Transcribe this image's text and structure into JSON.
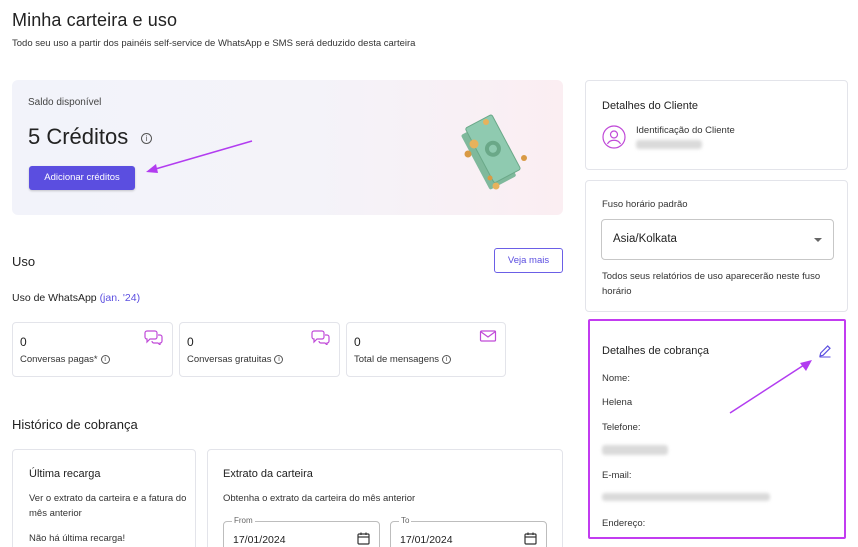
{
  "header": {
    "title": "Minha carteira e uso",
    "subtitle": "Todo seu uso a partir dos painéis self-service de WhatsApp e SMS será deduzido desta carteira"
  },
  "balance": {
    "label": "Saldo disponível",
    "value": "5 Créditos",
    "info_icon": "i",
    "add_button": "Adicionar créditos"
  },
  "usage": {
    "title": "Uso",
    "see_more": "Veja mais",
    "whatsapp_label": "Uso de WhatsApp",
    "period": "(jan. '24)",
    "stats": [
      {
        "value": "0",
        "label": "Conversas pagas*",
        "icon": "chat-bubbles-icon"
      },
      {
        "value": "0",
        "label": "Conversas gratuitas",
        "icon": "chat-bubbles-icon"
      },
      {
        "value": "0",
        "label": "Total de mensagens",
        "icon": "envelope-icon"
      }
    ],
    "info_glyph": "i"
  },
  "billing_history": {
    "title": "Histórico de cobrança",
    "last_recharge": {
      "title": "Última recarga",
      "text": "Ver o extrato da carteira e a fatura do mês anterior",
      "empty": "Não há última recarga!"
    },
    "statement": {
      "title": "Extrato da carteira",
      "text": "Obtenha o extrato da carteira do mês anterior",
      "from_label": "From",
      "from_value": "17/01/2024",
      "to_label": "To",
      "to_value": "17/01/2024"
    }
  },
  "client": {
    "title": "Detalhes do Cliente",
    "id_label": "Identificação do Cliente"
  },
  "timezone": {
    "title": "Fuso horário padrão",
    "value": "Asia/Kolkata",
    "note": "Todos seus relatórios de uso aparecerão neste fuso horário"
  },
  "billing_details": {
    "title": "Detalhes de cobrança",
    "name_label": "Nome:",
    "name_value": "Helena",
    "phone_label": "Telefone:",
    "email_label": "E-mail:",
    "address_label": "Endereço:"
  },
  "colors": {
    "accent": "#5b4ee0",
    "highlight": "#c23cf0",
    "annotation_arrow": "#b23cf0",
    "icon_pink": "#c04ad8"
  }
}
